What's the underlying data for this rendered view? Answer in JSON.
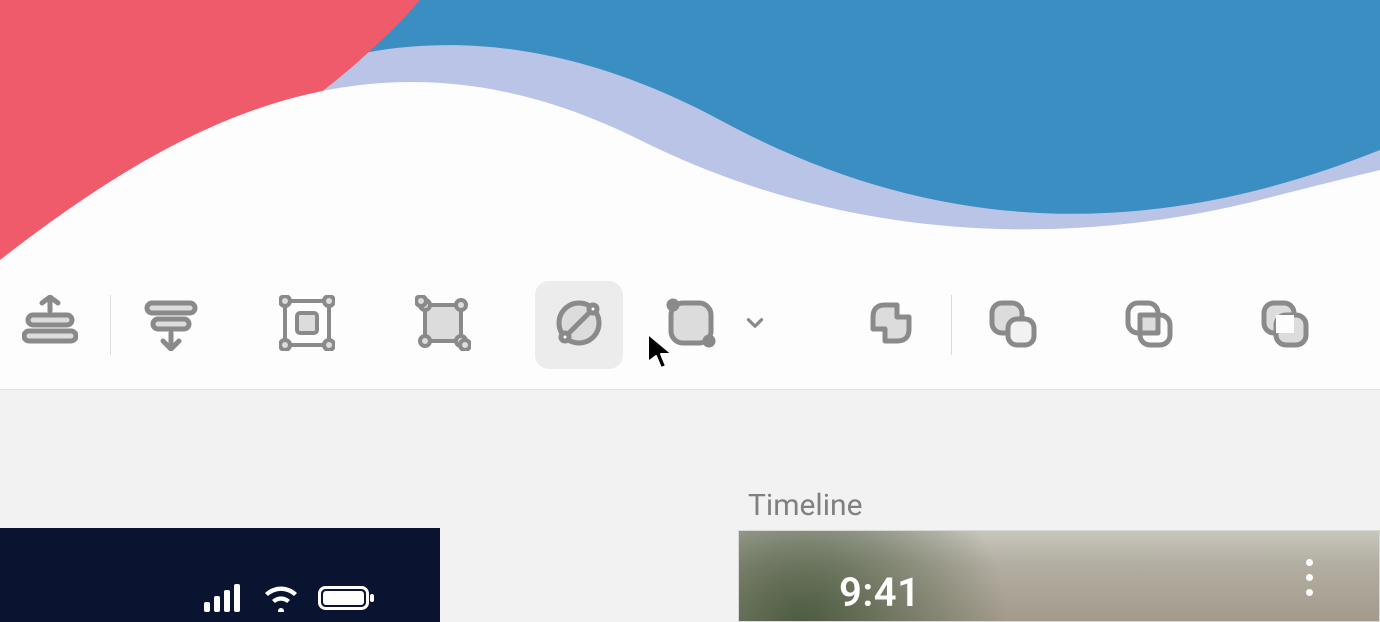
{
  "toolbar": {
    "items": [
      {
        "name": "distribute-vertical",
        "kind": "icon"
      },
      {
        "name": "separator"
      },
      {
        "name": "distribute-horizontal",
        "kind": "icon"
      },
      {
        "name": "gap"
      },
      {
        "name": "group-enter",
        "kind": "icon"
      },
      {
        "name": "gap"
      },
      {
        "name": "group-exit",
        "kind": "icon"
      },
      {
        "name": "gap"
      },
      {
        "name": "rotate-tool",
        "kind": "icon",
        "highlight": true
      },
      {
        "name": "gap-sm"
      },
      {
        "name": "corner-radius",
        "kind": "icon"
      },
      {
        "name": "chevron-down",
        "kind": "chevron"
      },
      {
        "name": "gap"
      },
      {
        "name": "boolean-union",
        "kind": "icon"
      },
      {
        "name": "separator"
      },
      {
        "name": "boolean-subtract",
        "kind": "icon"
      },
      {
        "name": "gap"
      },
      {
        "name": "boolean-intersect",
        "kind": "icon"
      },
      {
        "name": "gap"
      },
      {
        "name": "boolean-difference",
        "kind": "icon"
      }
    ]
  },
  "artboards": {
    "left": {
      "status_time": ""
    },
    "right": {
      "label": "Timeline",
      "time": "9:41"
    }
  },
  "colors": {
    "toolbar_bg": "#fdfdfd",
    "canvas_bg": "#f2f2f2",
    "left_artboard_bg": "#0a1431",
    "icon_stroke": "#8a8a8a"
  }
}
